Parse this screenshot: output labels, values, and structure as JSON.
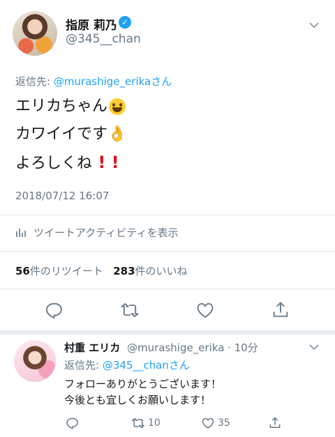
{
  "tweet": {
    "author_name": "指原 莉乃",
    "handle": "@345__chan",
    "reply_prefix": "返信先: ",
    "reply_to": "@murashige_erikaさん",
    "lines": [
      "エリカちゃん",
      "カワイイです",
      "よろしくね"
    ],
    "emojis": [
      "grinning-face-emoji",
      "ok-hand-emoji",
      "exclamation-emoji"
    ],
    "timestamp": "2018/07/12 16:07",
    "activity_label": "ツイートアクティビティを表示",
    "retweet_count": "56",
    "retweet_label": "件のリツイート",
    "like_count": "283",
    "like_label": "件のいいね",
    "icons": [
      "reply-icon",
      "retweet-icon",
      "like-icon",
      "share-icon"
    ]
  },
  "reply": {
    "author_name": "村重 エリカ",
    "handle_time": "@murashige_erika · 10分",
    "reply_prefix": "返信先: ",
    "reply_to": "@345__chanさん",
    "lines": [
      "フォローありがとうございます！",
      "今後とも宜しくお願いします！"
    ],
    "retweet_count": "10",
    "like_count": "35"
  },
  "colors": {
    "accent": "#1da1f2",
    "muted": "#657786",
    "divider": "#e1e8ed"
  }
}
